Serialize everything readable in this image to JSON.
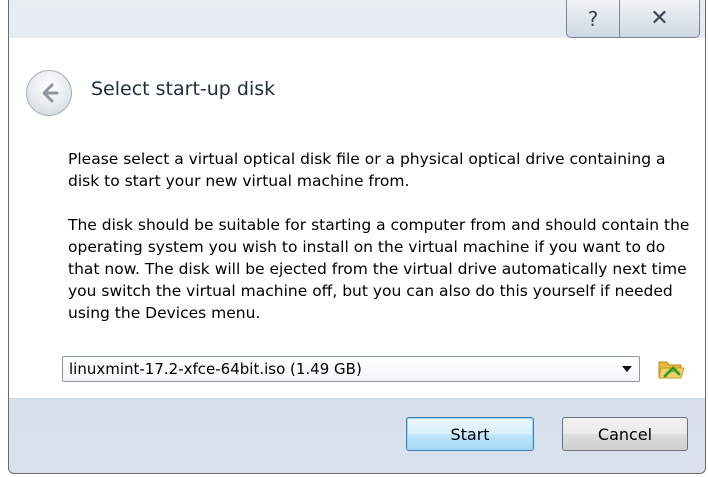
{
  "titlebar": {
    "help_glyph": "?",
    "close_glyph": "✕",
    "help_icon": "help-icon",
    "close_icon": "close-icon"
  },
  "header": {
    "back_icon": "back-arrow-icon",
    "title": "Select start-up disk"
  },
  "content": {
    "paragraph_1": "Please select a virtual optical disk file or a physical optical drive containing a disk to start your new virtual machine from.",
    "paragraph_2": "The disk should be suitable for starting a computer from and should contain the operating system you wish to install on the virtual machine if you want to do that now. The disk will be ejected from the virtual drive automatically next time you switch the virtual machine off, but you can also do this yourself if needed using the Devices menu.",
    "disk_select": {
      "value": "linuxmint-17.2-xfce-64bit.iso (1.49 GB)"
    },
    "choose_file_icon": "folder-open-icon"
  },
  "footer": {
    "start_label": "Start",
    "cancel_label": "Cancel"
  },
  "colors": {
    "title_text": "#1c2d42",
    "default_button_border": "#3c7fb1",
    "frame_background": "#d5dfe9"
  }
}
